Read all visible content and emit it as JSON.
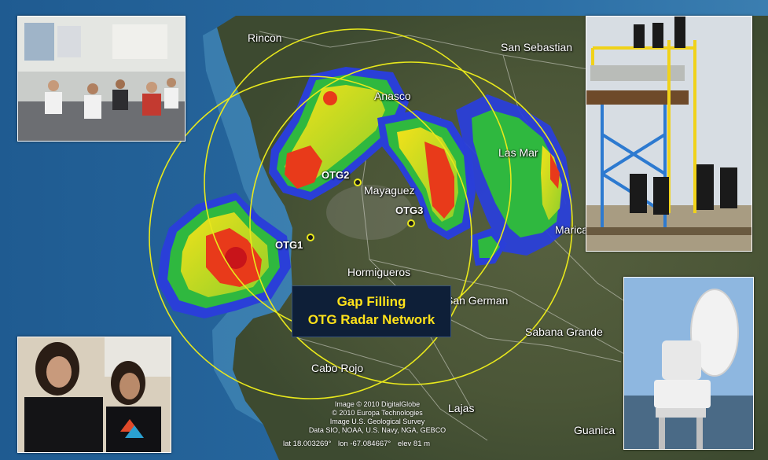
{
  "title": {
    "line1": "Gap Filling",
    "line2": "OTG Radar Network"
  },
  "places": [
    {
      "name": "Rincon"
    },
    {
      "name": "San Sebastian"
    },
    {
      "name": "Mayaguez"
    },
    {
      "name": "Hormigueros"
    },
    {
      "name": "San German"
    },
    {
      "name": "Sabana Grande"
    },
    {
      "name": "Cabo Rojo"
    },
    {
      "name": "Lajas"
    },
    {
      "name": "Guanica"
    },
    {
      "name": "Las Mar"
    },
    {
      "name": "Maricao"
    },
    {
      "name": "Anasco"
    }
  ],
  "radars": [
    {
      "label": "OTG1"
    },
    {
      "label": "OTG2"
    },
    {
      "label": "OTG3"
    }
  ],
  "credits": [
    "Image © 2010 DigitalGlobe",
    "© 2010 Europa Technologies",
    "Image U.S. Geological Survey",
    "Data SIO, NOAA, U.S. Navy, NGA, GEBCO"
  ],
  "status_bar": {
    "lat": "lat  18.003269°",
    "lon": "lon  -67.084667°",
    "elev": "elev  81 m"
  },
  "colors": {
    "ocean": "#2a6aa0",
    "land": "#4a5a3a",
    "range_ring": "#e8e81c",
    "title_text": "#ffe21a",
    "title_bg": "#0e1f38"
  }
}
